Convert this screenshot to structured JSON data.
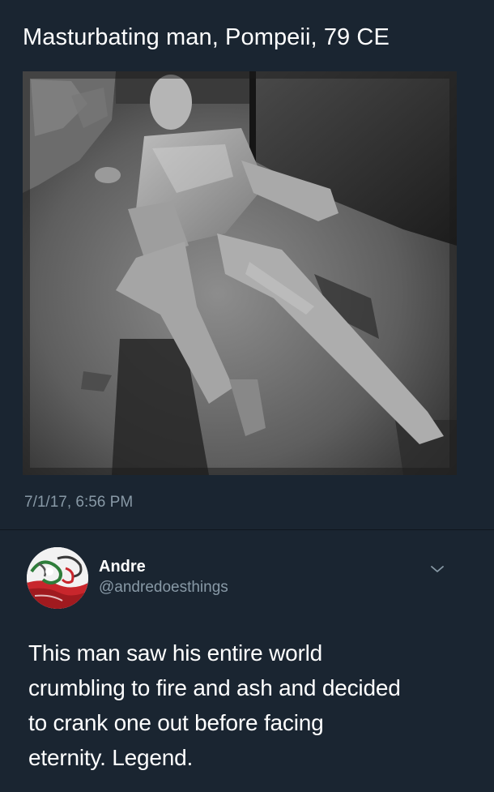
{
  "quoted_tweet": {
    "text": "Masturbating man, Pompeii, 79 CE",
    "timestamp": "7/1/17, 6:56 PM",
    "image": "plaster-cast-photo"
  },
  "reply_tweet": {
    "display_name": "Andre",
    "handle": "@andredoesthings",
    "body_lines": [
      "This man saw his entire world",
      "crumbling to fire and ash and decided",
      "to crank one out before facing",
      "eternity. Legend."
    ],
    "avatar": "swirl-avatar",
    "menu_icon": "chevron-down-icon"
  },
  "colors": {
    "background": "#1a2531",
    "primary_text": "#ffffff",
    "secondary_text": "#8899a6"
  }
}
